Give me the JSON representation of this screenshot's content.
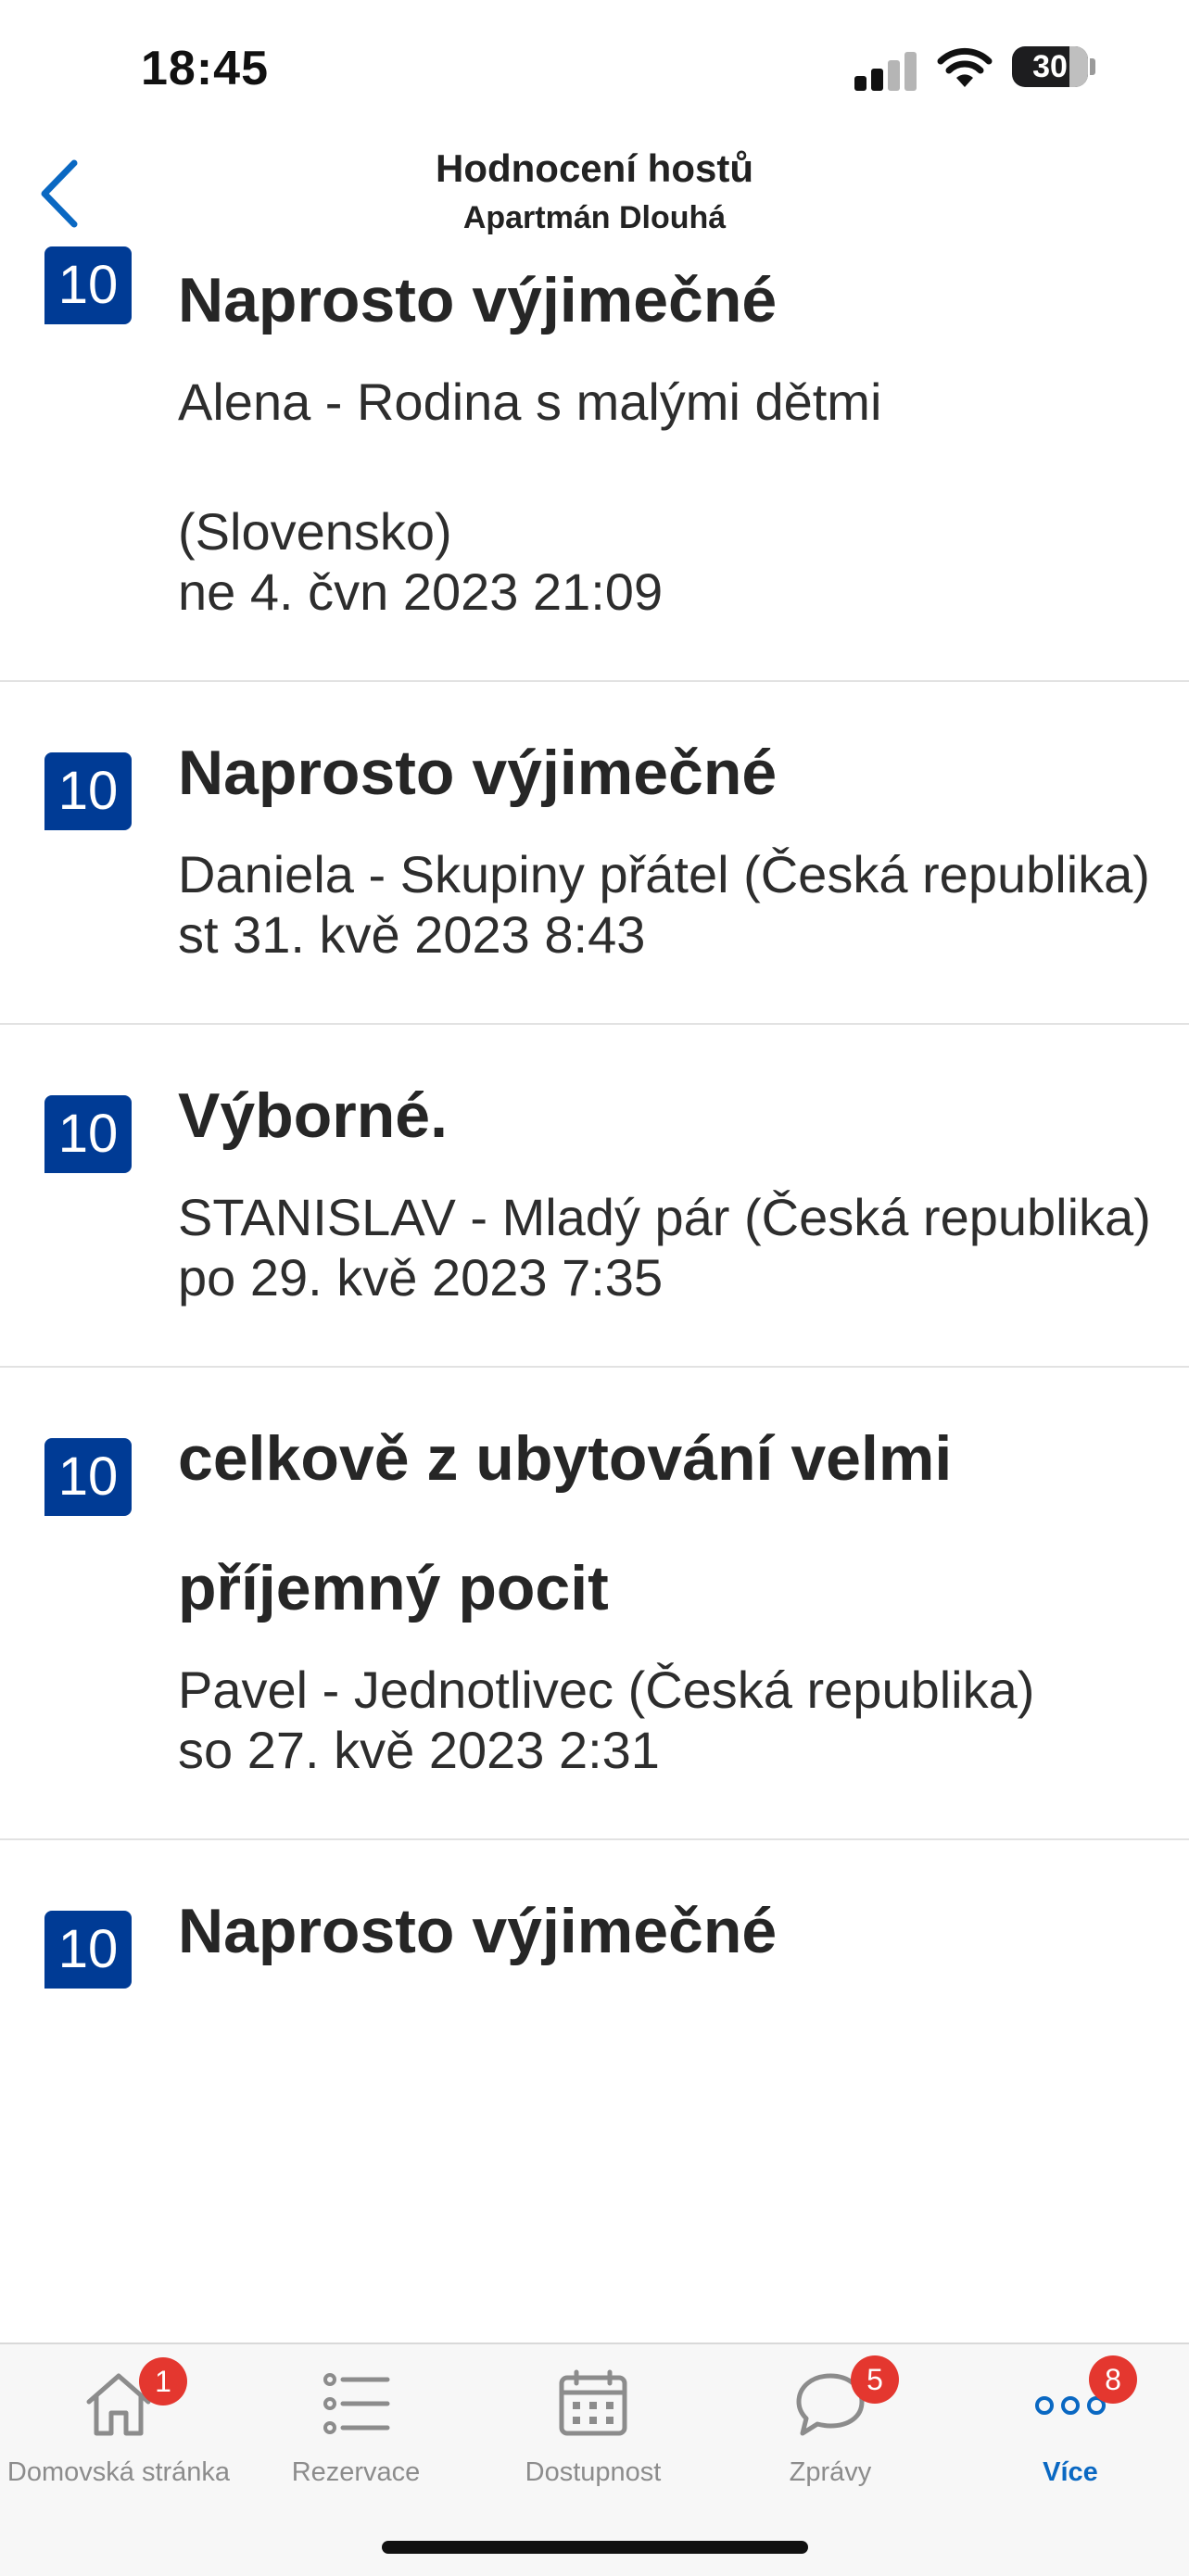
{
  "status_bar": {
    "time": "18:45",
    "battery": "30"
  },
  "header": {
    "title": "Hodnocení hostů",
    "subtitle": "Apartmán Dlouhá"
  },
  "reviews": [
    {
      "score": "10",
      "title": "Naprosto výjimečné",
      "author": "Alena - Rodina s malými dětmi (Slovensko)",
      "date": "ne 4. čvn 2023 21:09"
    },
    {
      "score": "10",
      "title": "Naprosto výjimečné",
      "author": "Daniela - Skupiny přátel (Česká republika)",
      "date": "st 31. kvě 2023 8:43"
    },
    {
      "score": "10",
      "title": "Výborné.",
      "author": "STANISLAV - Mladý pár (Česká republika)",
      "date": "po 29. kvě 2023 7:35"
    },
    {
      "score": "10",
      "title": "celkově z ubytování velmi příjemný pocit",
      "author": "Pavel - Jednotlivec (Česká republika)",
      "date": "so 27. kvě 2023 2:31"
    },
    {
      "score": "10",
      "title": "Naprosto výjimečné"
    }
  ],
  "tabbar": {
    "home": {
      "label": "Domovská stránka",
      "badge": "1",
      "icon": "home-icon"
    },
    "reservations": {
      "label": "Rezervace",
      "icon": "list-icon"
    },
    "availability": {
      "label": "Dostupnost",
      "icon": "calendar-icon"
    },
    "messages": {
      "label": "Zprávy",
      "badge": "5",
      "icon": "chat-icon"
    },
    "more": {
      "label": "Více",
      "badge": "8",
      "icon": "more-icon",
      "active": true
    }
  },
  "colors": {
    "accent": "#0a68c2",
    "badge_bg": "#003b95",
    "notification": "#e4372f"
  }
}
